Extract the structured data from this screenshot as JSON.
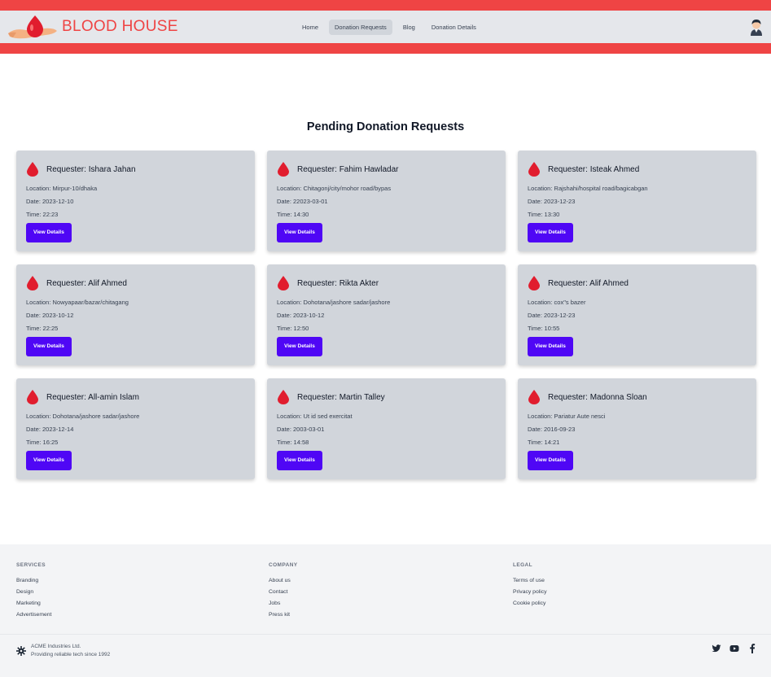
{
  "brand": {
    "name": "BLOOD HOUSE",
    "logo_icon": "blood-drop-hand-icon"
  },
  "nav": {
    "items": [
      {
        "label": "Home",
        "active": false
      },
      {
        "label": "Donation Requests",
        "active": true
      },
      {
        "label": "Blog",
        "active": false
      },
      {
        "label": "Donation Details",
        "active": false
      }
    ],
    "avatar_icon": "user-avatar-icon"
  },
  "main": {
    "title": "Pending Donation Requests",
    "requests": [
      {
        "requester": "Requester: Ishara Jahan",
        "location": "Location: Mirpur-10/dhaka",
        "date": "Date: 2023-12-10",
        "time": "Time: 22:23",
        "button": "View Details"
      },
      {
        "requester": "Requester: Fahim Hawladar",
        "location": "Location: Chitagonj/city/mohor road/bypas",
        "date": "Date: 22023-03-01",
        "time": "Time: 14:30",
        "button": "View Details"
      },
      {
        "requester": "Requester: Isteak Ahmed",
        "location": "Location: Rajshahi/hospital road/bagicabgan",
        "date": "Date: 2023-12-23",
        "time": "Time: 13:30",
        "button": "View Details"
      },
      {
        "requester": "Requester: Alif Ahmed",
        "location": "Location: Nowyapaar/bazar/chitagang",
        "date": "Date: 2023-10-12",
        "time": "Time: 22:25",
        "button": "View Details"
      },
      {
        "requester": "Requester: Rikta Akter",
        "location": "Location: Dohotana/jashore sadar/jashore",
        "date": "Date: 2023-10-12",
        "time": "Time: 12:50",
        "button": "View Details"
      },
      {
        "requester": "Requester: Alif Ahmed",
        "location": "Location: cox\"s bazer",
        "date": "Date: 2023-12-23",
        "time": "Time: 10:55",
        "button": "View Details"
      },
      {
        "requester": "Requester: All-amin Islam",
        "location": "Location: Dohotana/jashore sadar/jashore",
        "date": "Date: 2023-12-14",
        "time": "Time: 16:25",
        "button": "View Details"
      },
      {
        "requester": "Requester: Martin Talley",
        "location": "Location: Ut id sed exercitat",
        "date": "Date: 2003-03-01",
        "time": "Time: 14:58",
        "button": "View Details"
      },
      {
        "requester": "Requester: Madonna Sloan",
        "location": "Location: Pariatur Aute nesci",
        "date": "Date: 2016-09-23",
        "time": "Time: 14:21",
        "button": "View Details"
      }
    ]
  },
  "footer": {
    "columns": [
      {
        "heading": "SERVICES",
        "links": [
          "Branding",
          "Design",
          "Marketing",
          "Advertisement"
        ]
      },
      {
        "heading": "COMPANY",
        "links": [
          "About us",
          "Contact",
          "Jobs",
          "Press kit"
        ]
      },
      {
        "heading": "LEGAL",
        "links": [
          "Terms of use",
          "Privacy policy",
          "Cookie policy"
        ]
      }
    ],
    "company_line1": "ACME Industries Ltd.",
    "company_line2": "Providing reliable tech since 1992",
    "company_icon": "gear-logo-icon",
    "socials": [
      "twitter-icon",
      "youtube-icon",
      "facebook-icon"
    ]
  },
  "colors": {
    "accent_red": "#ef4444",
    "button_purple": "#4f07f5",
    "card_bg": "#d1d5db"
  }
}
